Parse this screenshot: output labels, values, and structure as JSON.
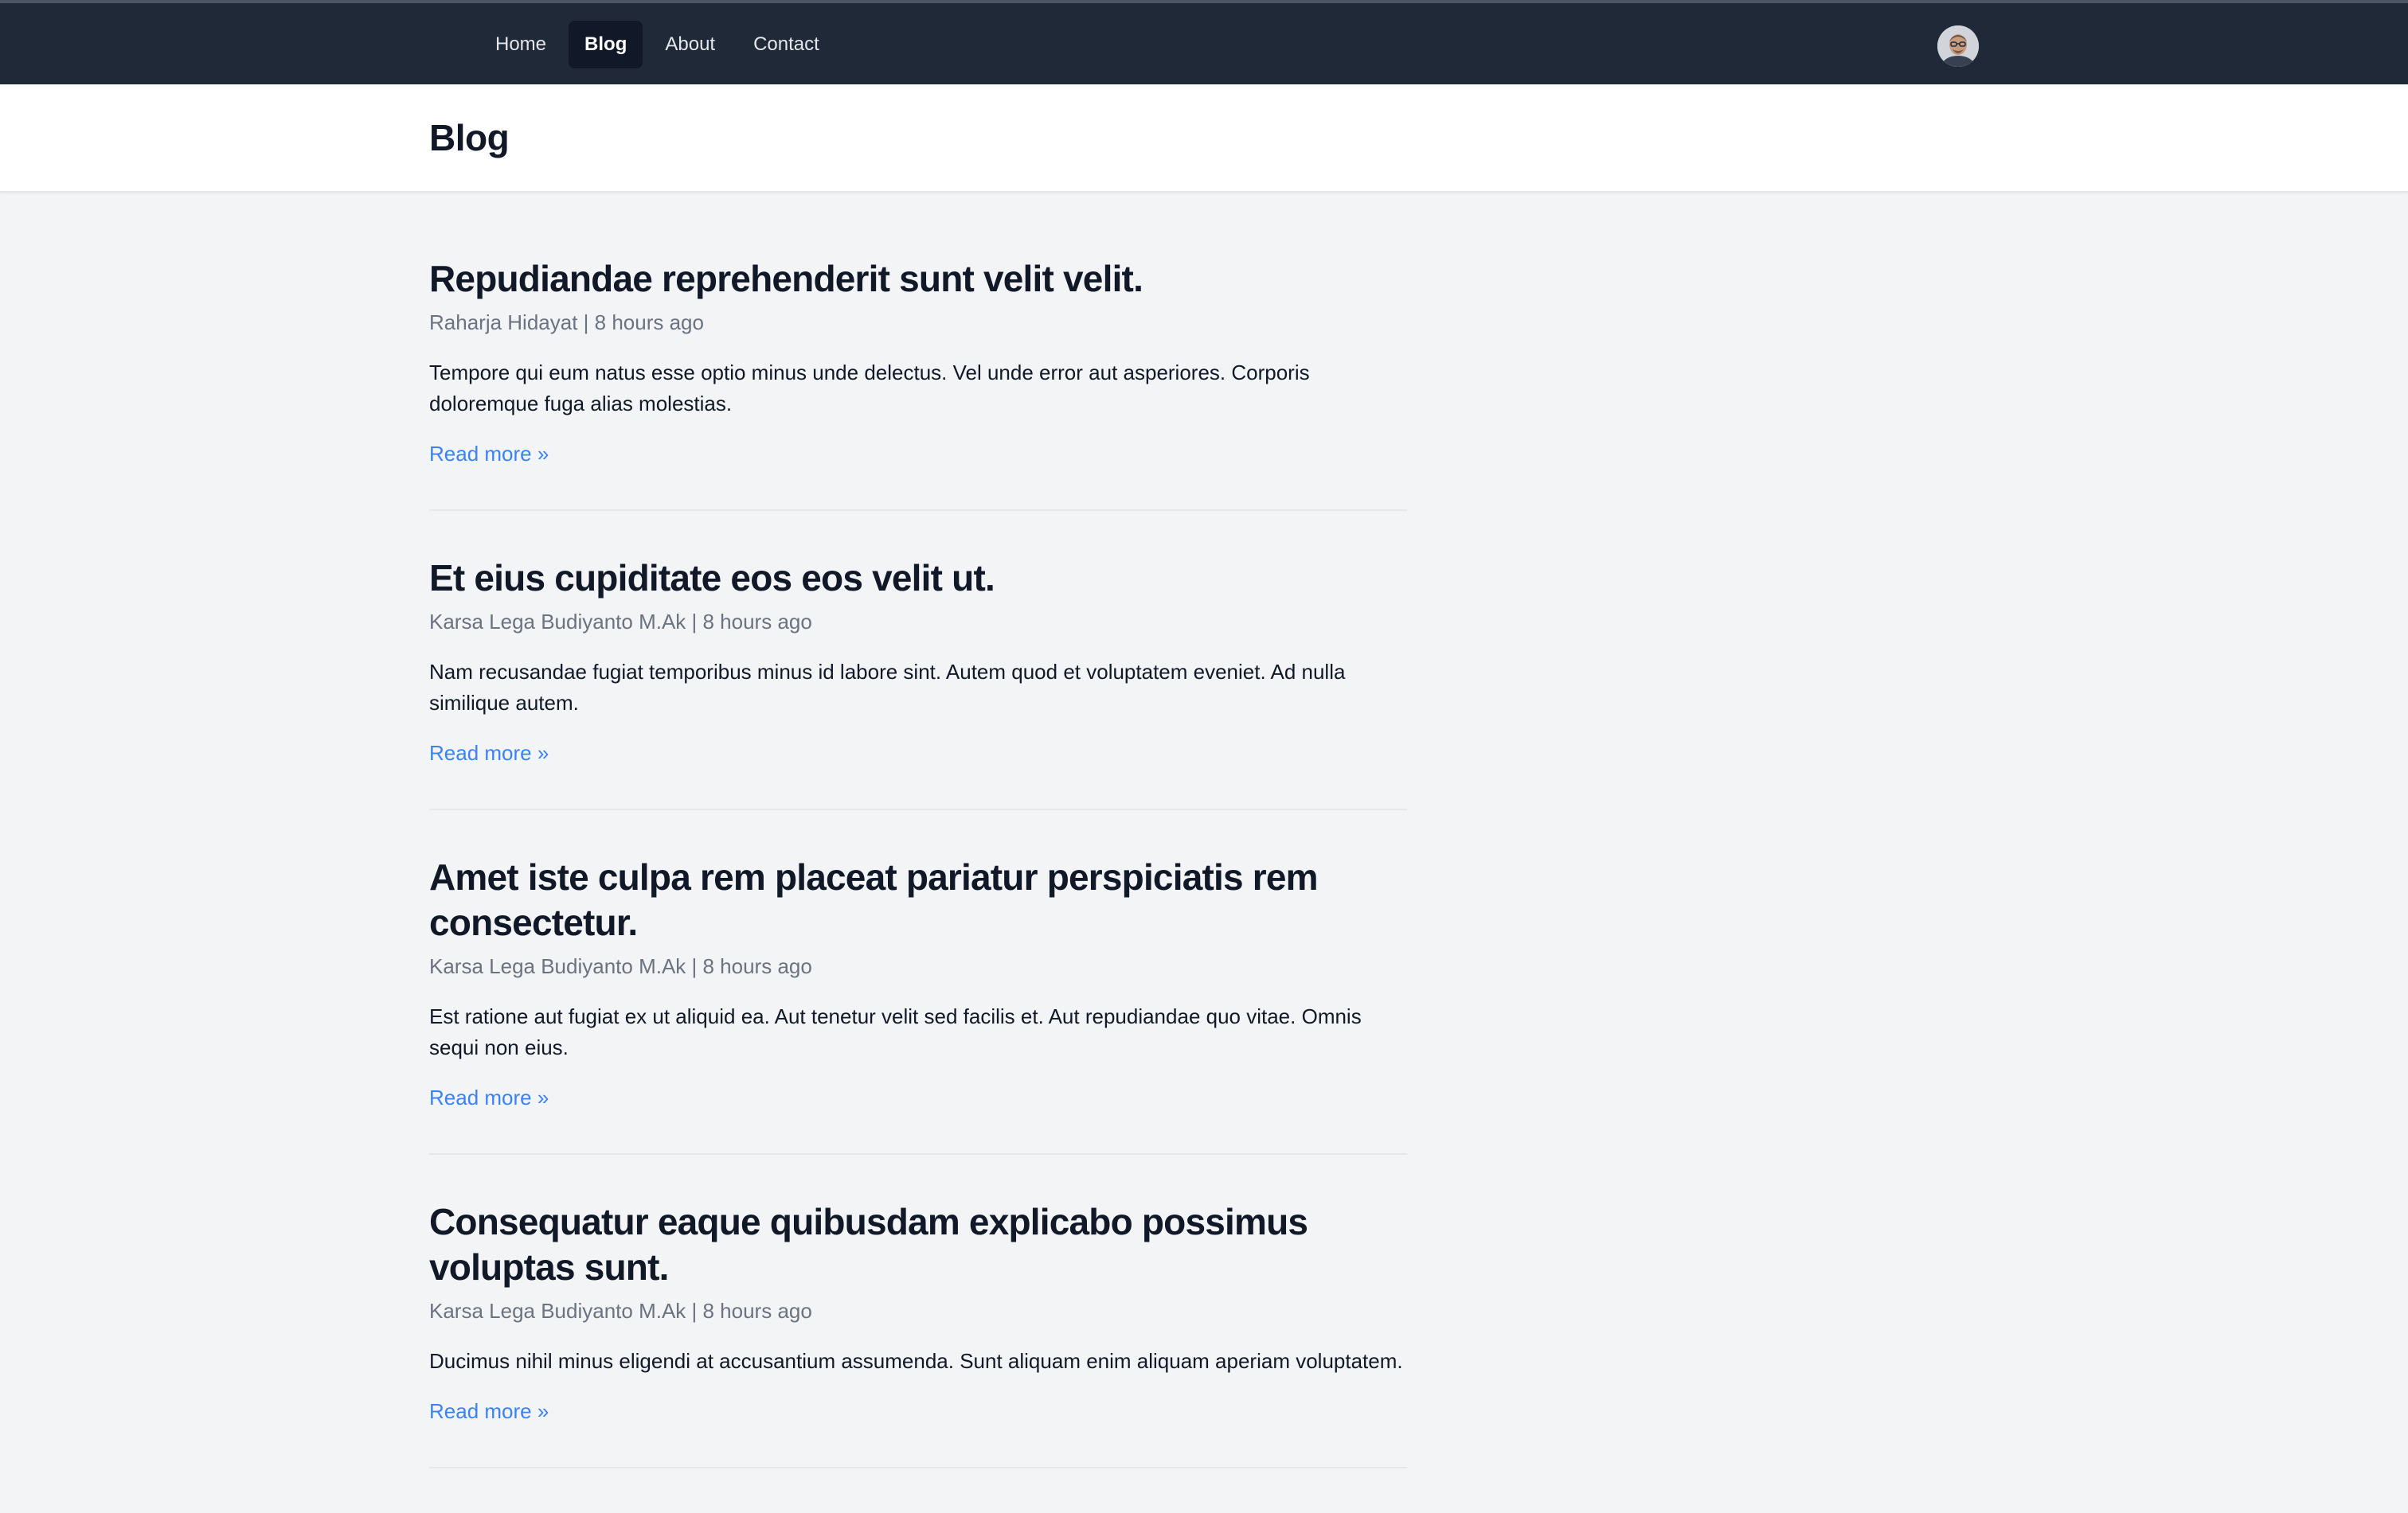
{
  "nav": {
    "links": [
      {
        "label": "Home",
        "active": false
      },
      {
        "label": "Blog",
        "active": true
      },
      {
        "label": "About",
        "active": false
      },
      {
        "label": "Contact",
        "active": false
      }
    ]
  },
  "header": {
    "title": "Blog"
  },
  "posts": [
    {
      "title": "Repudiandae reprehenderit sunt velit velit.",
      "meta": "Raharja Hidayat | 8 hours ago",
      "excerpt": "Tempore qui eum natus esse optio minus unde delectus. Vel unde error aut asperiores. Corporis doloremque fuga alias molestias.",
      "read_more": "Read more »"
    },
    {
      "title": "Et eius cupiditate eos eos velit ut.",
      "meta": "Karsa Lega Budiyanto M.Ak | 8 hours ago",
      "excerpt": "Nam recusandae fugiat temporibus minus id labore sint. Autem quod et voluptatem eveniet. Ad nulla similique autem.",
      "read_more": "Read more »"
    },
    {
      "title": "Amet iste culpa rem placeat pariatur perspiciatis rem consectetur.",
      "meta": "Karsa Lega Budiyanto M.Ak | 8 hours ago",
      "excerpt": "Est ratione aut fugiat ex ut aliquid ea. Aut tenetur velit sed facilis et. Aut repudiandae quo vitae. Omnis sequi non eius.",
      "read_more": "Read more »"
    },
    {
      "title": "Consequatur eaque quibusdam explicabo possimus voluptas sunt.",
      "meta": "Karsa Lega Budiyanto M.Ak | 8 hours ago",
      "excerpt": "Ducimus nihil minus eligendi at accusantium assumenda. Sunt aliquam enim aliquam aperiam voluptatem.",
      "read_more": "Read more »"
    }
  ],
  "colors": {
    "nav_bg": "#1f2937",
    "page_bg": "#f3f4f6",
    "link": "#3b82f6"
  }
}
